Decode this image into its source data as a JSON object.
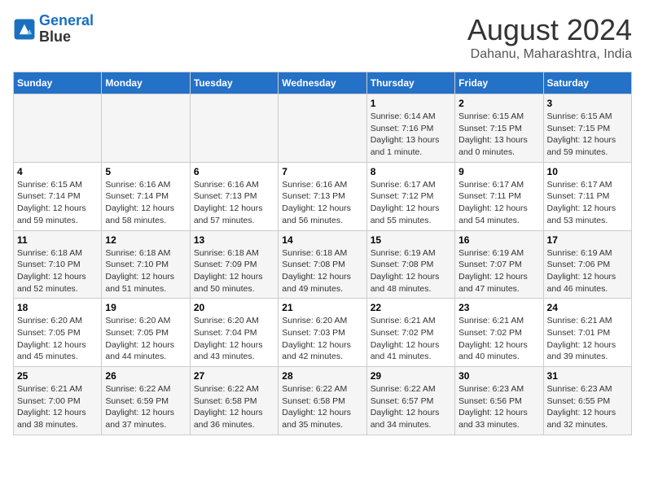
{
  "header": {
    "logo_line1": "General",
    "logo_line2": "Blue",
    "month_year": "August 2024",
    "location": "Dahanu, Maharashtra, India"
  },
  "days_of_week": [
    "Sunday",
    "Monday",
    "Tuesday",
    "Wednesday",
    "Thursday",
    "Friday",
    "Saturday"
  ],
  "weeks": [
    [
      {
        "day": "",
        "info": ""
      },
      {
        "day": "",
        "info": ""
      },
      {
        "day": "",
        "info": ""
      },
      {
        "day": "",
        "info": ""
      },
      {
        "day": "1",
        "info": "Sunrise: 6:14 AM\nSunset: 7:16 PM\nDaylight: 13 hours\nand 1 minute."
      },
      {
        "day": "2",
        "info": "Sunrise: 6:15 AM\nSunset: 7:15 PM\nDaylight: 13 hours\nand 0 minutes."
      },
      {
        "day": "3",
        "info": "Sunrise: 6:15 AM\nSunset: 7:15 PM\nDaylight: 12 hours\nand 59 minutes."
      }
    ],
    [
      {
        "day": "4",
        "info": "Sunrise: 6:15 AM\nSunset: 7:14 PM\nDaylight: 12 hours\nand 59 minutes."
      },
      {
        "day": "5",
        "info": "Sunrise: 6:16 AM\nSunset: 7:14 PM\nDaylight: 12 hours\nand 58 minutes."
      },
      {
        "day": "6",
        "info": "Sunrise: 6:16 AM\nSunset: 7:13 PM\nDaylight: 12 hours\nand 57 minutes."
      },
      {
        "day": "7",
        "info": "Sunrise: 6:16 AM\nSunset: 7:13 PM\nDaylight: 12 hours\nand 56 minutes."
      },
      {
        "day": "8",
        "info": "Sunrise: 6:17 AM\nSunset: 7:12 PM\nDaylight: 12 hours\nand 55 minutes."
      },
      {
        "day": "9",
        "info": "Sunrise: 6:17 AM\nSunset: 7:11 PM\nDaylight: 12 hours\nand 54 minutes."
      },
      {
        "day": "10",
        "info": "Sunrise: 6:17 AM\nSunset: 7:11 PM\nDaylight: 12 hours\nand 53 minutes."
      }
    ],
    [
      {
        "day": "11",
        "info": "Sunrise: 6:18 AM\nSunset: 7:10 PM\nDaylight: 12 hours\nand 52 minutes."
      },
      {
        "day": "12",
        "info": "Sunrise: 6:18 AM\nSunset: 7:10 PM\nDaylight: 12 hours\nand 51 minutes."
      },
      {
        "day": "13",
        "info": "Sunrise: 6:18 AM\nSunset: 7:09 PM\nDaylight: 12 hours\nand 50 minutes."
      },
      {
        "day": "14",
        "info": "Sunrise: 6:18 AM\nSunset: 7:08 PM\nDaylight: 12 hours\nand 49 minutes."
      },
      {
        "day": "15",
        "info": "Sunrise: 6:19 AM\nSunset: 7:08 PM\nDaylight: 12 hours\nand 48 minutes."
      },
      {
        "day": "16",
        "info": "Sunrise: 6:19 AM\nSunset: 7:07 PM\nDaylight: 12 hours\nand 47 minutes."
      },
      {
        "day": "17",
        "info": "Sunrise: 6:19 AM\nSunset: 7:06 PM\nDaylight: 12 hours\nand 46 minutes."
      }
    ],
    [
      {
        "day": "18",
        "info": "Sunrise: 6:20 AM\nSunset: 7:05 PM\nDaylight: 12 hours\nand 45 minutes."
      },
      {
        "day": "19",
        "info": "Sunrise: 6:20 AM\nSunset: 7:05 PM\nDaylight: 12 hours\nand 44 minutes."
      },
      {
        "day": "20",
        "info": "Sunrise: 6:20 AM\nSunset: 7:04 PM\nDaylight: 12 hours\nand 43 minutes."
      },
      {
        "day": "21",
        "info": "Sunrise: 6:20 AM\nSunset: 7:03 PM\nDaylight: 12 hours\nand 42 minutes."
      },
      {
        "day": "22",
        "info": "Sunrise: 6:21 AM\nSunset: 7:02 PM\nDaylight: 12 hours\nand 41 minutes."
      },
      {
        "day": "23",
        "info": "Sunrise: 6:21 AM\nSunset: 7:02 PM\nDaylight: 12 hours\nand 40 minutes."
      },
      {
        "day": "24",
        "info": "Sunrise: 6:21 AM\nSunset: 7:01 PM\nDaylight: 12 hours\nand 39 minutes."
      }
    ],
    [
      {
        "day": "25",
        "info": "Sunrise: 6:21 AM\nSunset: 7:00 PM\nDaylight: 12 hours\nand 38 minutes."
      },
      {
        "day": "26",
        "info": "Sunrise: 6:22 AM\nSunset: 6:59 PM\nDaylight: 12 hours\nand 37 minutes."
      },
      {
        "day": "27",
        "info": "Sunrise: 6:22 AM\nSunset: 6:58 PM\nDaylight: 12 hours\nand 36 minutes."
      },
      {
        "day": "28",
        "info": "Sunrise: 6:22 AM\nSunset: 6:58 PM\nDaylight: 12 hours\nand 35 minutes."
      },
      {
        "day": "29",
        "info": "Sunrise: 6:22 AM\nSunset: 6:57 PM\nDaylight: 12 hours\nand 34 minutes."
      },
      {
        "day": "30",
        "info": "Sunrise: 6:23 AM\nSunset: 6:56 PM\nDaylight: 12 hours\nand 33 minutes."
      },
      {
        "day": "31",
        "info": "Sunrise: 6:23 AM\nSunset: 6:55 PM\nDaylight: 12 hours\nand 32 minutes."
      }
    ]
  ]
}
